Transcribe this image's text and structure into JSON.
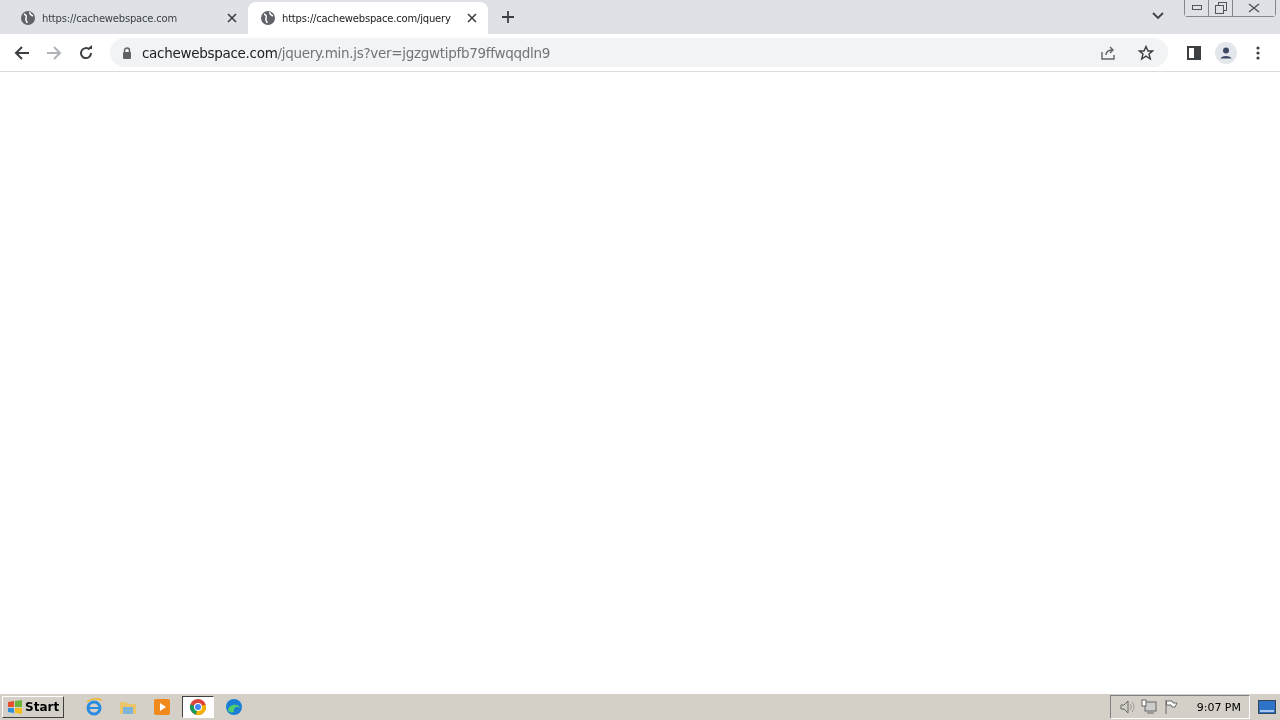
{
  "tabs": [
    {
      "title": "https://cachewebspace.com",
      "selected": false
    },
    {
      "title": "https://cachewebspace.com/jquery",
      "selected": true
    }
  ],
  "address": {
    "host": "cachewebspace.com",
    "path": "/jquery.min.js?ver=jgzgwtipfb79ffwqqdln9"
  },
  "taskbar": {
    "start_label": "Start",
    "apps": [
      {
        "kind": "ie",
        "active": false
      },
      {
        "kind": "folder",
        "active": false
      },
      {
        "kind": "media",
        "active": false
      },
      {
        "kind": "chrome",
        "active": true
      },
      {
        "kind": "edge",
        "active": false
      }
    ],
    "clock": "9:07 PM"
  }
}
